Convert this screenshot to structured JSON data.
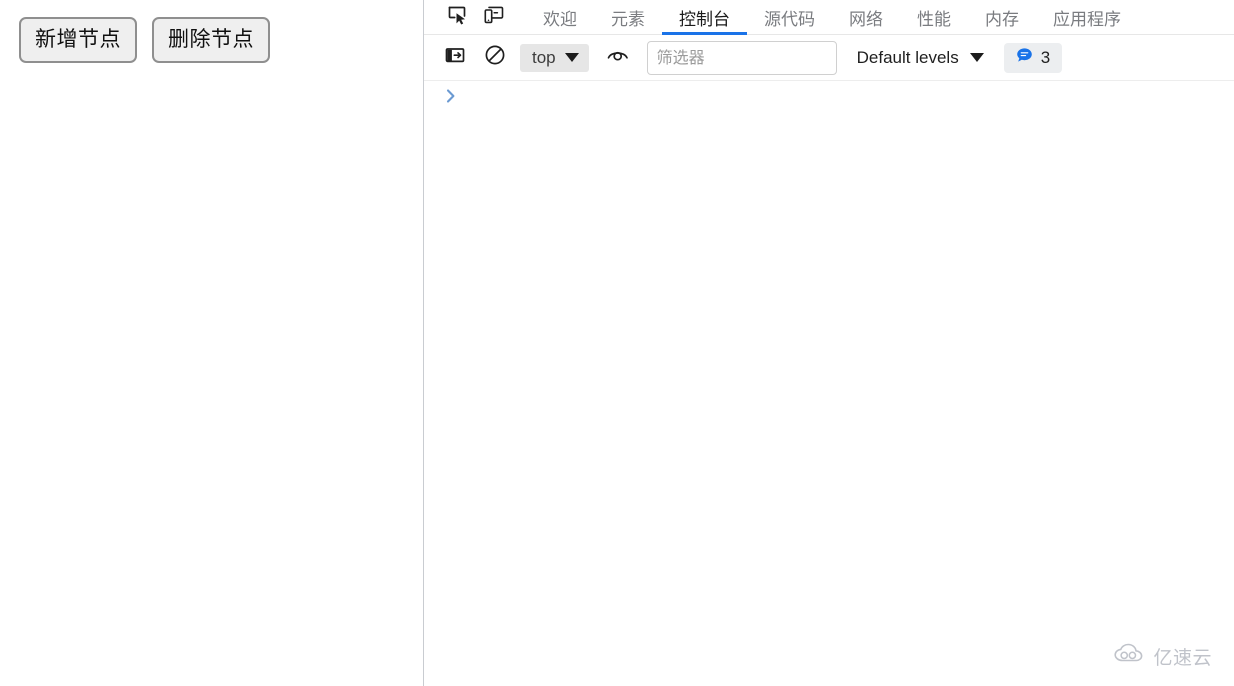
{
  "page": {
    "buttons": [
      {
        "label": "新增节点",
        "name": "add-node-button"
      },
      {
        "label": "删除节点",
        "name": "delete-node-button"
      }
    ]
  },
  "devtools": {
    "icons": {
      "inspect": "inspect-element-icon",
      "device": "device-toolbar-icon",
      "sidebar_toggle": "console-sidebar-toggle-icon",
      "clear": "clear-console-icon",
      "eye": "create-live-expression-icon",
      "message_bubble": "message-bubble-icon",
      "prompt_chevron": "prompt-chevron-icon",
      "cloud": "cloud-logo-icon"
    },
    "tabs": [
      {
        "label": "欢迎",
        "active": false
      },
      {
        "label": "元素",
        "active": false
      },
      {
        "label": "控制台",
        "active": true
      },
      {
        "label": "源代码",
        "active": false
      },
      {
        "label": "网络",
        "active": false
      },
      {
        "label": "性能",
        "active": false
      },
      {
        "label": "内存",
        "active": false
      },
      {
        "label": "应用程序",
        "active": false
      }
    ],
    "console_toolbar": {
      "context_value": "top",
      "filter_placeholder": "筛选器",
      "filter_value": "",
      "levels_value": "Default levels",
      "message_count": "3"
    },
    "console_body": {
      "prompt": ">",
      "entries": []
    }
  },
  "watermark": {
    "text": "亿速云"
  },
  "colors": {
    "accent": "#1a73e8",
    "tab_inactive": "#7a7c80",
    "tab_active": "#1a1a1a",
    "divider": "#c9ccd1",
    "button_face": "#efefef",
    "button_border": "#8f8f8f",
    "badge_bg": "#eceef0",
    "context_bg": "#e6e6e6",
    "watermark": "#9aa0ab"
  }
}
